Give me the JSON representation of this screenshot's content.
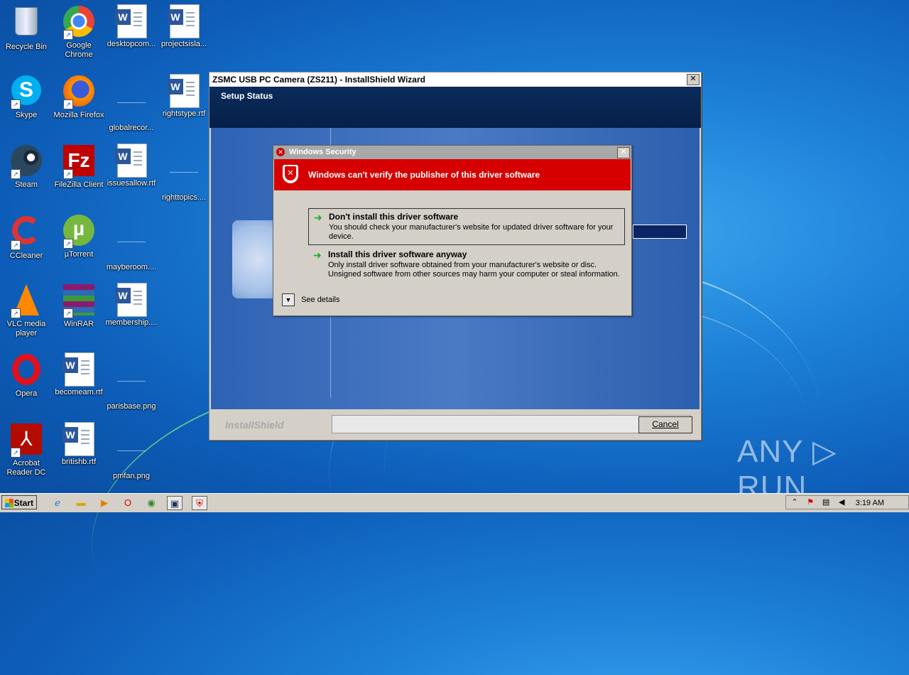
{
  "desktop": {
    "icons": [
      {
        "label": "Recycle Bin"
      },
      {
        "label": "Google Chrome"
      },
      {
        "label": "desktopcom..."
      },
      {
        "label": "projectsisla..."
      },
      {
        "label": "Skype"
      },
      {
        "label": "Mozilla Firefox"
      },
      {
        "label": "globalrecor..."
      },
      {
        "label": "rightstype.rtf"
      },
      {
        "label": "Steam"
      },
      {
        "label": "FileZilla Client"
      },
      {
        "label": "issuesallow.rtf"
      },
      {
        "label": "righttopics...."
      },
      {
        "label": "CCleaner"
      },
      {
        "label": "µTorrent"
      },
      {
        "label": "mayberoom...."
      },
      {
        "label": "VLC media player"
      },
      {
        "label": "WinRAR"
      },
      {
        "label": "membership...."
      },
      {
        "label": "Opera"
      },
      {
        "label": "becomeam.rtf"
      },
      {
        "label": "parisbase.png"
      },
      {
        "label": "Acrobat Reader DC"
      },
      {
        "label": "britishb.rtf"
      },
      {
        "label": "pmfan.png"
      }
    ]
  },
  "wizard": {
    "title": "ZSMC USB PC Camera (ZS211) - InstallShield Wizard",
    "close": "✕",
    "header": "Setup Status",
    "brand": "InstallShield",
    "cancel_label": "Cancel"
  },
  "security": {
    "title": "Windows Security",
    "close": "✕",
    "banner": "Windows can't verify the publisher of this driver software",
    "option1_title": "Don't install this driver software",
    "option1_desc": "You should check your manufacturer's website for updated driver software for your device.",
    "option2_title": "Install this driver software anyway",
    "option2_desc": "Only install driver software obtained from your manufacturer's website or disc. Unsigned software from other sources may harm your computer or steal information.",
    "details_label": "See details"
  },
  "taskbar": {
    "start_label": "Start",
    "clock": "3:19 AM"
  },
  "watermark": "ANY ▷ RUN",
  "colors": {
    "banner_red": "#d60000",
    "wizard_header": "#0b2b5c",
    "desktop_blue": "#1c7fd6"
  }
}
